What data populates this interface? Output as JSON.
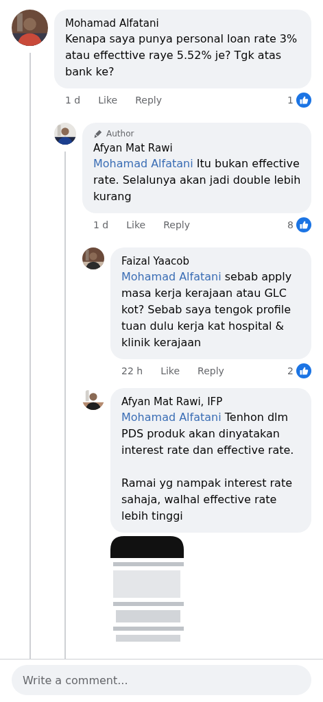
{
  "comments": [
    {
      "author": "Mohamad Alfatani",
      "text": "Kenapa saya punya personal loan rate 3% atau effecttive raye 5.52% je? Tgk atas bank ke?",
      "time": "1 d",
      "like": "Like",
      "reply": "Reply",
      "reactions": "1",
      "children": [
        {
          "badge": "Author",
          "author": "Afyan Mat Rawi",
          "mention": "Mohamad Alfatani",
          "text": "Itu bukan effective rate. Selalunya akan jadi double lebih kurang",
          "time": "1 d",
          "like": "Like",
          "reply": "Reply",
          "reactions": "8",
          "children": [
            {
              "author": "Faizal Yaacob",
              "mention": "Mohamad Alfatani",
              "text": "sebab apply masa kerja kerajaan atau GLC kot? Sebab saya tengok profile tuan dulu kerja kat hospital & klinik kerajaan",
              "time": "22 h",
              "like": "Like",
              "reply": "Reply",
              "reactions": "2"
            },
            {
              "author": "Afyan Mat Rawi, IFP",
              "mention": "Mohamad Alfatani",
              "text": "Tenhon dlm PDS produk akan dinyatakan interest rate dan effective rate.\n\nRamai yg nampak interest rate sahaja, walhal effective rate lebih tinggi"
            }
          ]
        }
      ]
    }
  ],
  "composer": {
    "placeholder": "Write a comment..."
  }
}
